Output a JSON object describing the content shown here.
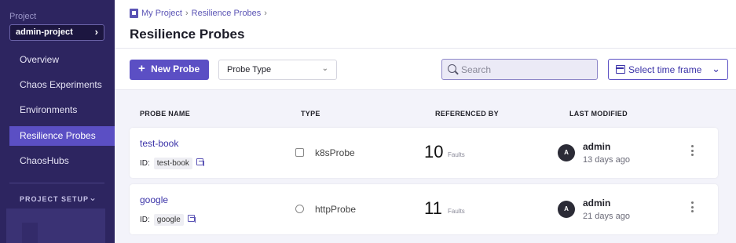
{
  "sidebar": {
    "project_label": "Project",
    "project_name": "admin-project",
    "items": [
      {
        "label": "Overview"
      },
      {
        "label": "Chaos Experiments"
      },
      {
        "label": "Environments"
      },
      {
        "label": "Resilience Probes"
      },
      {
        "label": "ChaosHubs"
      }
    ],
    "active_index": 3,
    "setup_label": "PROJECT SETUP"
  },
  "header": {
    "breadcrumbs": [
      "My Project",
      "Resilience Probes"
    ],
    "title": "Resilience Probes"
  },
  "toolbar": {
    "new_probe_label": "New Probe",
    "probe_type_placeholder": "Probe Type",
    "search_placeholder": "Search",
    "timeframe_label": "Select time frame"
  },
  "table": {
    "columns": [
      "PROBE NAME",
      "TYPE",
      "REFERENCED BY",
      "LAST MODIFIED"
    ],
    "rows": [
      {
        "name": "test-book",
        "id_label": "ID:",
        "id": "test-book",
        "type": "k8sProbe",
        "type_icon": "kubernetes-icon",
        "ref_count": "10",
        "ref_unit": "Faults",
        "avatar": "A",
        "user": "admin",
        "modified": "13 days ago"
      },
      {
        "name": "google",
        "id_label": "ID:",
        "id": "google",
        "type": "httpProbe",
        "type_icon": "globe-icon",
        "ref_count": "11",
        "ref_unit": "Faults",
        "avatar": "A",
        "user": "admin",
        "modified": "21 days ago"
      }
    ]
  },
  "colors": {
    "sidebar_bg": "#2d2560",
    "accent": "#5b4fc4",
    "link": "#3b33a8"
  }
}
